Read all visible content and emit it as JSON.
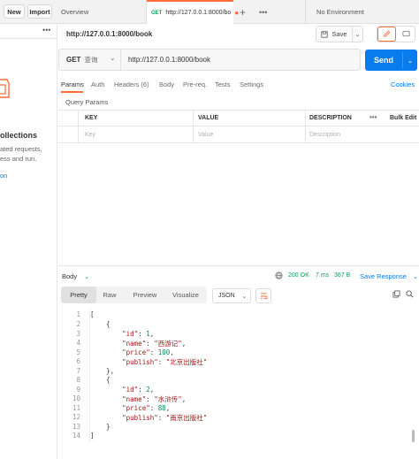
{
  "sidebar": {
    "new_label": "New",
    "import_label": "Import",
    "collections_text": "ollections",
    "desc_line1": "ated requests,",
    "desc_line2": "ess and run.",
    "link_text": "on"
  },
  "tabs": {
    "overview_label": "Overview",
    "active_method": "GET",
    "active_url": "http://127.0.0.1:8000/bo",
    "environment_label": "No Environment"
  },
  "request": {
    "title": "http://127.0.0.1:8000/book",
    "save_label": "Save",
    "method": "GET",
    "method_name": "查询",
    "url": "http://127.0.0.1:8000/book",
    "send_label": "Send"
  },
  "request_tabs": {
    "params": "Params",
    "auth": "Auth",
    "headers": "Headers (6)",
    "body": "Body",
    "prereq": "Pre-req.",
    "tests": "Tests",
    "settings": "Settings",
    "cookies": "Cookies"
  },
  "params": {
    "section_label": "Query Params",
    "col_key": "KEY",
    "col_value": "VALUE",
    "col_description": "DESCRIPTION",
    "bulk_edit": "Bulk Edit",
    "key_placeholder": "Key",
    "value_placeholder": "Value",
    "description_placeholder": "Description"
  },
  "response": {
    "body_label": "Body",
    "status": "200 OK",
    "time": "7 ms",
    "size": "367 B",
    "save_response": "Save Response",
    "view_pretty": "Pretty",
    "view_raw": "Raw",
    "view_preview": "Preview",
    "view_visualize": "Visualize",
    "format": "JSON"
  },
  "colors": {
    "accent": "#ff6c37",
    "primary": "#097bed",
    "status_ok": "#0f9d58"
  }
}
